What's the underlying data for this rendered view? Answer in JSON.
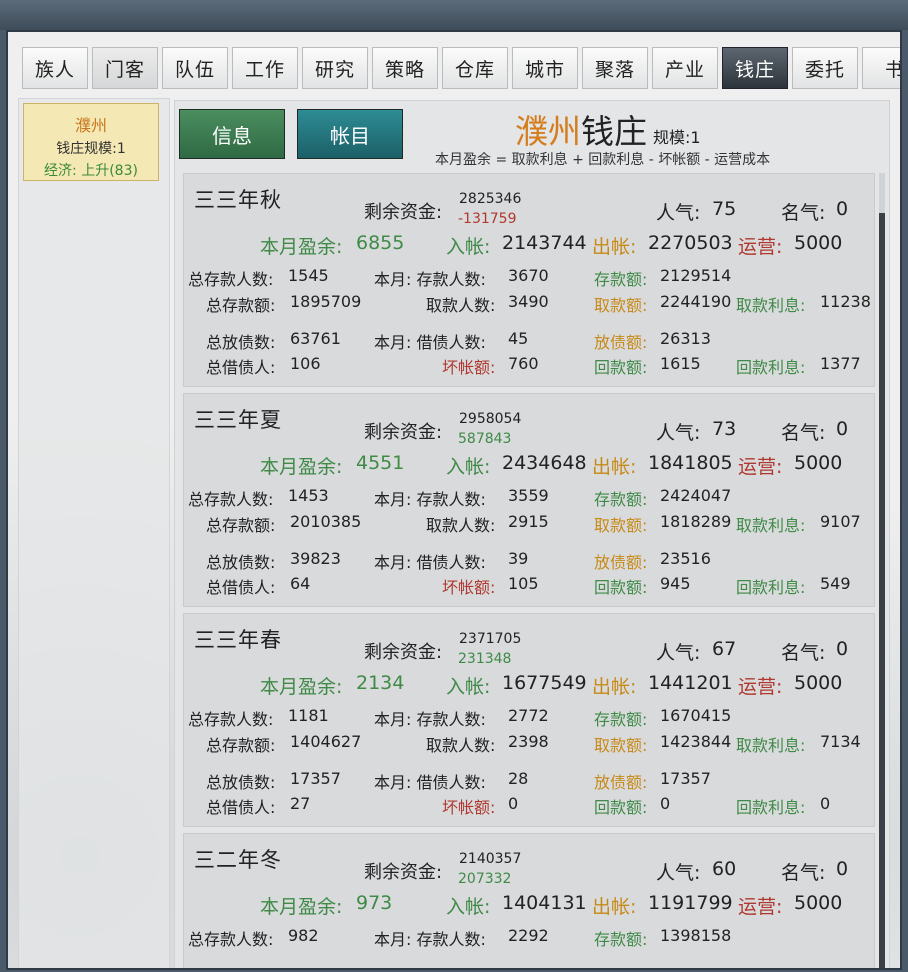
{
  "tabs": [
    {
      "label": "族人",
      "state": "normal"
    },
    {
      "label": "门客",
      "state": "dim"
    },
    {
      "label": "队伍",
      "state": "normal"
    },
    {
      "label": "工作",
      "state": "normal"
    },
    {
      "label": "研究",
      "state": "normal"
    },
    {
      "label": "策略",
      "state": "normal"
    },
    {
      "label": "仓库",
      "state": "normal"
    },
    {
      "label": "城市",
      "state": "normal"
    },
    {
      "label": "聚落",
      "state": "normal"
    },
    {
      "label": "产业",
      "state": "normal"
    },
    {
      "label": "钱庄",
      "state": "active"
    },
    {
      "label": "委托",
      "state": "normal"
    },
    {
      "label": "书",
      "state": "normal"
    }
  ],
  "sidebar": {
    "city_name": "濮州",
    "scale_text": "钱庄规模:1",
    "economy_text": "经济: 上升(83)"
  },
  "header": {
    "info_button": "信息",
    "account_button": "帐目",
    "city": "濮州",
    "bank": "钱庄",
    "scale": "规模:1",
    "formula": "本月盈余 = 取款利息 + 回款利息 - 坏帐额 - 运营成本"
  },
  "labels": {
    "remaining_funds": "剩余资金:",
    "popularity": "人气:",
    "fame": "名气:",
    "monthly_surplus": "本月盈余:",
    "income": "入帐:",
    "outflow": "出帐:",
    "operation": "运营:",
    "total_depositors": "总存款人数:",
    "month_depositors": "本月: 存款人数:",
    "deposit_amount": "存款额:",
    "total_deposits": "总存款额:",
    "withdrawers": "取款人数:",
    "withdraw_amount": "取款额:",
    "withdraw_interest": "取款利息:",
    "total_loans": "总放债数:",
    "month_borrowers": "本月: 借债人数:",
    "loan_amount": "放债额:",
    "total_borrowers": "总借债人:",
    "bad_debt": "坏帐额:",
    "repayment": "回款额:",
    "repayment_interest": "回款利息:"
  },
  "records": [
    {
      "season": "三三年秋",
      "funds": "2825346",
      "delta": "-131759",
      "delta_sign": "neg",
      "popularity": "75",
      "fame": "0",
      "surplus": "6855",
      "income": "2143744",
      "outflow": "2270503",
      "operation": "5000",
      "total_depositors": "1545",
      "month_depositors": "3670",
      "deposit_amount": "2129514",
      "total_deposits": "1895709",
      "withdrawers": "3490",
      "withdraw_amount": "2244190",
      "withdraw_interest": "11238",
      "total_loans": "63761",
      "month_borrowers": "45",
      "loan_amount": "26313",
      "total_borrowers": "106",
      "bad_debt": "760",
      "repayment": "1615",
      "repayment_interest": "1377"
    },
    {
      "season": "三三年夏",
      "funds": "2958054",
      "delta": "587843",
      "delta_sign": "pos",
      "popularity": "73",
      "fame": "0",
      "surplus": "4551",
      "income": "2434648",
      "outflow": "1841805",
      "operation": "5000",
      "total_depositors": "1453",
      "month_depositors": "3559",
      "deposit_amount": "2424047",
      "total_deposits": "2010385",
      "withdrawers": "2915",
      "withdraw_amount": "1818289",
      "withdraw_interest": "9107",
      "total_loans": "39823",
      "month_borrowers": "39",
      "loan_amount": "23516",
      "total_borrowers": "64",
      "bad_debt": "105",
      "repayment": "945",
      "repayment_interest": "549"
    },
    {
      "season": "三三年春",
      "funds": "2371705",
      "delta": "231348",
      "delta_sign": "pos",
      "popularity": "67",
      "fame": "0",
      "surplus": "2134",
      "income": "1677549",
      "outflow": "1441201",
      "operation": "5000",
      "total_depositors": "1181",
      "month_depositors": "2772",
      "deposit_amount": "1670415",
      "total_deposits": "1404627",
      "withdrawers": "2398",
      "withdraw_amount": "1423844",
      "withdraw_interest": "7134",
      "total_loans": "17357",
      "month_borrowers": "28",
      "loan_amount": "17357",
      "total_borrowers": "27",
      "bad_debt": "0",
      "repayment": "0",
      "repayment_interest": "0"
    },
    {
      "season": "三二年冬",
      "funds": "2140357",
      "delta": "207332",
      "delta_sign": "pos",
      "popularity": "60",
      "fame": "0",
      "surplus": "973",
      "income": "1404131",
      "outflow": "1191799",
      "operation": "5000",
      "total_depositors": "982",
      "month_depositors": "2292",
      "deposit_amount": "1398158"
    }
  ]
}
